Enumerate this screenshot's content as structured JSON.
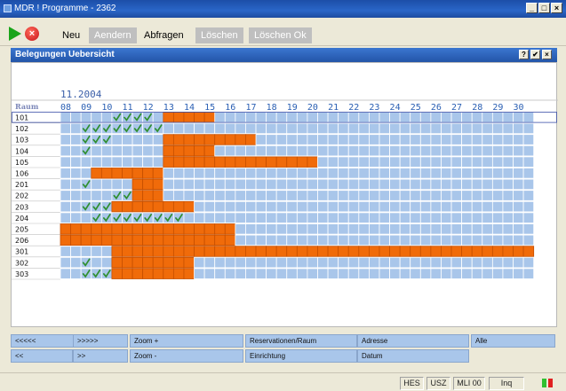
{
  "window": {
    "title": "MDR ! Programme - 2362",
    "controls": [
      "_",
      "□",
      "×"
    ]
  },
  "toolbar": {
    "icons": [
      "play-icon",
      "cancel-icon"
    ],
    "buttons": [
      {
        "label": "Neu",
        "enabled": true
      },
      {
        "label": "Aendern",
        "enabled": false
      },
      {
        "label": "Abfragen",
        "enabled": true
      },
      {
        "label": "Löschen",
        "enabled": false
      },
      {
        "label": "Löschen Ok",
        "enabled": false
      }
    ]
  },
  "panel": {
    "title": "Belegungen Uebersicht",
    "buttons": [
      "?",
      "✔",
      "×"
    ]
  },
  "schedule": {
    "month_label": "11.2004",
    "room_header": "Raum",
    "days": [
      "08",
      "09",
      "10",
      "11",
      "12",
      "13",
      "14",
      "15",
      "16",
      "17",
      "18",
      "19",
      "20",
      "21",
      "22",
      "23",
      "24",
      "25",
      "26",
      "27",
      "28",
      "29",
      "30"
    ],
    "rooms": [
      {
        "name": "101",
        "check": [
          5,
          6,
          7,
          8
        ],
        "orange": [
          [
            10,
            14
          ]
        ]
      },
      {
        "name": "102",
        "check": [
          2,
          3,
          4,
          5,
          6,
          7,
          8,
          9
        ],
        "orange": []
      },
      {
        "name": "103",
        "check": [
          2,
          3,
          4
        ],
        "orange": [
          [
            10,
            18
          ]
        ]
      },
      {
        "name": "104",
        "check": [
          2
        ],
        "orange": [
          [
            10,
            14
          ]
        ]
      },
      {
        "name": "105",
        "check": [],
        "orange": [
          [
            10,
            24
          ]
        ]
      },
      {
        "name": "106",
        "check": [],
        "orange": [
          [
            3,
            9
          ]
        ]
      },
      {
        "name": "201",
        "check": [
          2
        ],
        "orange": [
          [
            7,
            9
          ]
        ]
      },
      {
        "name": "202",
        "check": [
          5,
          6
        ],
        "orange": [
          [
            7,
            9
          ]
        ]
      },
      {
        "name": "203",
        "check": [
          2,
          3,
          4
        ],
        "orange": [
          [
            5,
            12
          ]
        ]
      },
      {
        "name": "204",
        "check": [
          3,
          4,
          5,
          6,
          7,
          8,
          9,
          10,
          11
        ],
        "orange": []
      },
      {
        "name": "205",
        "check": [],
        "orange": [
          [
            0,
            16
          ]
        ]
      },
      {
        "name": "206",
        "check": [],
        "orange": [
          [
            0,
            16
          ]
        ]
      },
      {
        "name": "301",
        "check": [],
        "orange": [
          [
            5,
            47
          ]
        ]
      },
      {
        "name": "302",
        "check": [
          2
        ],
        "orange": [
          [
            5,
            12
          ]
        ]
      },
      {
        "name": "303",
        "check": [
          2,
          3,
          4
        ],
        "orange": [
          [
            5,
            12
          ]
        ]
      }
    ]
  },
  "bottom_buttons": [
    {
      "label": "<<<<<",
      "name": "page-back-button"
    },
    {
      "label": ">>>>>",
      "name": "page-forward-button"
    },
    {
      "label": "Zoom +",
      "name": "zoom-in-button"
    },
    {
      "label": "Reservationen/Raum",
      "name": "reservationen-raum-button"
    },
    {
      "label": "Adresse",
      "name": "adresse-button"
    },
    {
      "label": "Alle",
      "name": "alle-button"
    },
    {
      "label": "<<",
      "name": "step-back-button"
    },
    {
      "label": ">>",
      "name": "step-forward-button"
    },
    {
      "label": "Zoom -",
      "name": "zoom-out-button"
    },
    {
      "label": "Einrichtung",
      "name": "einrichtung-button"
    },
    {
      "label": "Datum",
      "name": "datum-button"
    }
  ],
  "statusbar": {
    "cells": [
      "HES",
      "USZ",
      "MLI 00",
      "Inq"
    ]
  },
  "colors": {
    "free": "#a9c6ea",
    "booked": "#f06b0a",
    "check": "#2f8f2f",
    "header_blue": "#2a5fb3",
    "month_blue": "#3a5ea8",
    "room_label": "#7b86b8"
  }
}
